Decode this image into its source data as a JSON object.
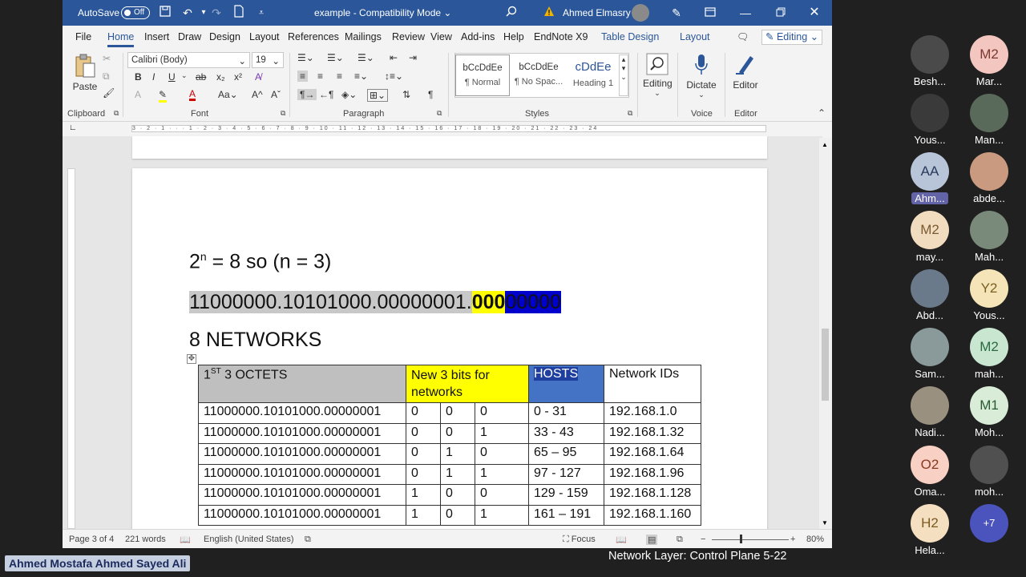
{
  "titlebar": {
    "autosave": "AutoSave",
    "autosave_state": "Off",
    "doc_title": "example - Compatibility Mode",
    "user": "Ahmed Elmasry"
  },
  "menu": {
    "tabs": [
      "File",
      "Home",
      "Insert",
      "Draw",
      "Design",
      "Layout",
      "References",
      "Mailings",
      "Review",
      "View",
      "Add-ins",
      "Help",
      "EndNote X9",
      "Table Design",
      "Layout"
    ],
    "editing": "Editing"
  },
  "ribbon": {
    "paste": "Paste",
    "font_name": "Calibri (Body)",
    "font_size": "19",
    "styles": [
      {
        "preview": "bCcDdEe",
        "name": "¶ Normal"
      },
      {
        "preview": "bCcDdEe",
        "name": "¶ No Spac..."
      },
      {
        "preview": "cDdEe",
        "name": "Heading 1"
      }
    ],
    "editing": "Editing",
    "dictate": "Dictate",
    "editor": "Editor",
    "groups": [
      "Clipboard",
      "Font",
      "Paragraph",
      "Styles",
      "Voice",
      "Editor"
    ]
  },
  "ruler_text": "3 · 2 · 1 · · · 1 · 2 · 3 · 4 · 5 · 6 · 7 · 8 · 9 · 10 · 11 · 12 · 13 · 14 · 15 · 16 · 17 · 18 · 19 · 20 · 21 · 22 · 23 · 24",
  "document": {
    "eq_base": "2",
    "eq_sup": "n",
    "eq_rest": " = 8 so (n = 3)",
    "ip_prefix": "11000000.10101000.00000001.",
    "ip_net_bits": "000",
    "ip_host_bits": "00000",
    "networks_title": "8 NETWORKS",
    "table": {
      "h_octets_pre": "1",
      "h_octets_sup": "ST",
      "h_octets_post": " 3 OCTETS",
      "h_new_bits": "New 3 bits for networks",
      "h_hosts": "HOSTS",
      "h_ids": "Network IDs",
      "rows": [
        {
          "octets": "11000000.10101000.00000001",
          "b1": "0",
          "b2": "0",
          "b3": "0",
          "hosts": "0 - 31",
          "id": "192.168.1.0"
        },
        {
          "octets": "11000000.10101000.00000001",
          "b1": "0",
          "b2": "0",
          "b3": "1",
          "hosts": "33 - 43",
          "id": "192.168.1.32"
        },
        {
          "octets": "11000000.10101000.00000001",
          "b1": "0",
          "b2": "1",
          "b3": "0",
          "hosts": "65 – 95",
          "id": "192.168.1.64"
        },
        {
          "octets": "11000000.10101000.00000001",
          "b1": "0",
          "b2": "1",
          "b3": "1",
          "hosts": "97 - 127",
          "id": "192.168.1.96"
        },
        {
          "octets": "11000000.10101000.00000001",
          "b1": "1",
          "b2": "0",
          "b3": "0",
          "hosts": "129 - 159",
          "id": "192.168.1.128"
        },
        {
          "octets": "11000000.10101000.00000001",
          "b1": "1",
          "b2": "0",
          "b3": "1",
          "hosts": "161 – 191",
          "id": "192.168.1.160"
        }
      ]
    }
  },
  "status": {
    "page": "Page 3 of 4",
    "words": "221 words",
    "lang": "English (United States)",
    "focus": "Focus",
    "zoom": "80%"
  },
  "participants": [
    {
      "initials": "",
      "name": "Besh...",
      "color": "#4a4a4a"
    },
    {
      "initials": "M2",
      "name": "Mar...",
      "color": "#f4c6c0"
    },
    {
      "initials": "",
      "name": "Yous...",
      "color": "#3a3a3a"
    },
    {
      "initials": "",
      "name": "Man...",
      "color": "#5a6a5a"
    },
    {
      "initials": "AA",
      "name": "Ahm...",
      "color": "#b8c4d8"
    },
    {
      "initials": "",
      "name": "abde...",
      "color": "#c99a80"
    },
    {
      "initials": "M2",
      "name": "may...",
      "color": "#f2dcc0"
    },
    {
      "initials": "",
      "name": "Mah...",
      "color": "#7a8a7a"
    },
    {
      "initials": "",
      "name": "Abd...",
      "color": "#6a7a8a"
    },
    {
      "initials": "Y2",
      "name": "Yous...",
      "color": "#f4e4b8"
    },
    {
      "initials": "",
      "name": "Sam...",
      "color": "#8a9a9a"
    },
    {
      "initials": "M2",
      "name": "mah...",
      "color": "#c8e6d0"
    },
    {
      "initials": "",
      "name": "Nadi...",
      "color": "#9a9080"
    },
    {
      "initials": "M1",
      "name": "Moh...",
      "color": "#d8ecd8"
    },
    {
      "initials": "O2",
      "name": "Oma...",
      "color": "#f8d0c4"
    },
    {
      "initials": "",
      "name": "moh...",
      "color": "#505050"
    },
    {
      "initials": "H2",
      "name": "Hela...",
      "color": "#f4e0c0"
    },
    {
      "initials": "+7",
      "name": "",
      "color": "#4b53bc"
    }
  ],
  "presenter": "Ahmed Mostafa Ahmed Sayed Ali",
  "slide_footer": "Network Layer: Control Plane  5-22",
  "colors": {
    "word_blue": "#2b579a",
    "highlight_gray": "#c8c8c8",
    "yellow": "#ffff00",
    "blue": "#0000cc",
    "hosts_header": "#4472c4"
  }
}
